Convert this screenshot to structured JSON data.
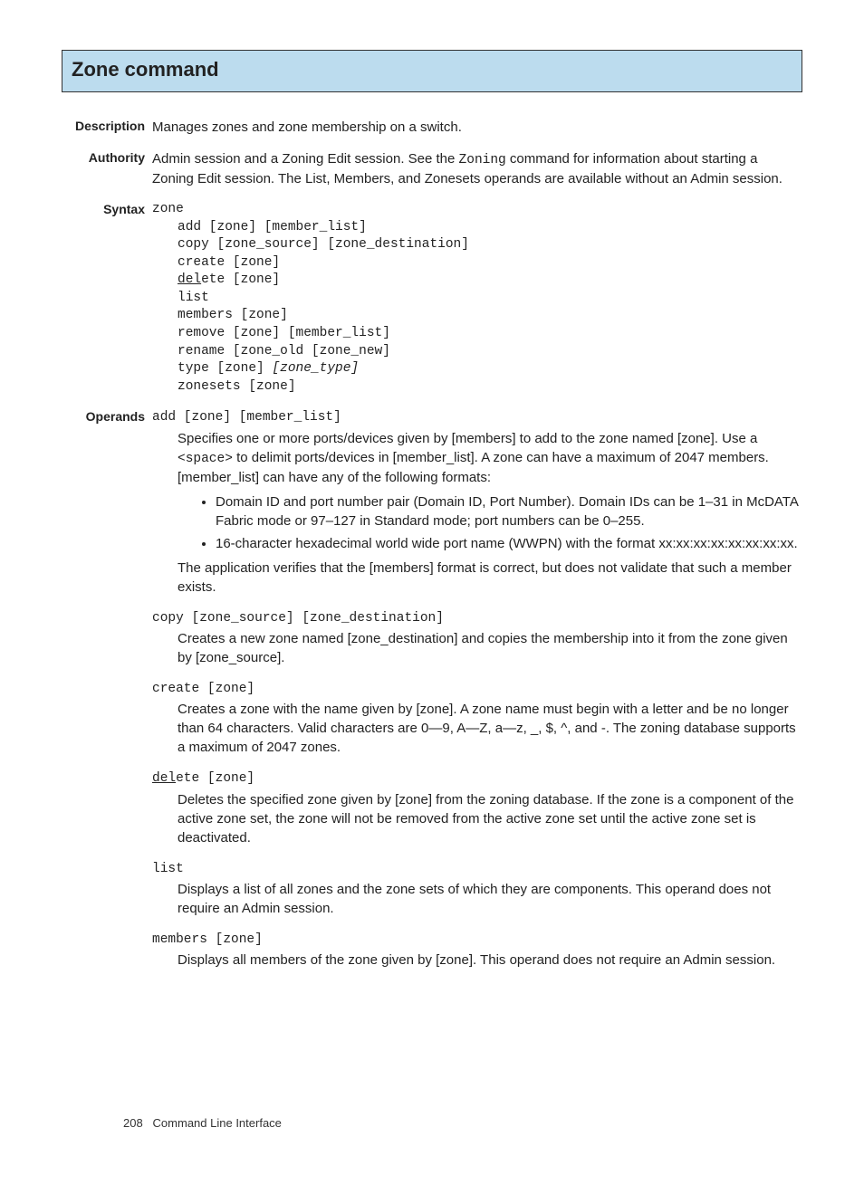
{
  "title": "Zone command",
  "description": {
    "label": "Description",
    "text": "Manages zones and zone membership on a switch."
  },
  "authority": {
    "label": "Authority",
    "pre": "Admin session and a Zoning Edit session. See the ",
    "cmd": "Zoning",
    "post": " command for information about starting a Zoning Edit session. The List, Members, and Zonesets operands are available without an Admin session."
  },
  "syntax": {
    "label": "Syntax",
    "keyword": "zone",
    "lines_pre": "add [zone] [member_list]\ncopy [zone_source] [zone_destination]\ncreate [zone]",
    "del_ul": "del",
    "del_rest": "ete [zone]",
    "lines_mid": "list\nmembers [zone]\nremove [zone] [member_list]\nrename [zone_old [zone_new]",
    "type_pre": "type [zone] ",
    "type_italic": "[zone_type]",
    "lines_post": "zonesets [zone]"
  },
  "operands": {
    "label": "Operands",
    "add": {
      "head": "add [zone] [member_list]",
      "p1a": "Specifies one or more ports/devices given by [members] to add to the zone named [zone]. Use a ",
      "p1b": "<space>",
      "p1c": " to delimit ports/devices in [member_list]. A zone can have a maximum of 2047 members. [member_list] can have any of the following formats:",
      "b1": "Domain ID and port number pair (Domain ID, Port Number). Domain IDs can be 1–31 in McDATA Fabric mode or 97–127 in Standard mode; port numbers can be 0–255.",
      "b2": "16-character hexadecimal world wide port name (WWPN) with the format xx:xx:xx:xx:xx:xx:xx:xx.",
      "p2": "The application verifies that the [members] format is correct, but does not validate that such a member exists."
    },
    "copy": {
      "head": "copy [zone_source] [zone_destination]",
      "desc": "Creates a new zone named [zone_destination] and copies the membership into it from the zone given by [zone_source]."
    },
    "create": {
      "head": "create [zone]",
      "desc": "Creates a zone with the name given by [zone]. A zone name must begin with a letter and be no longer than 64 characters. Valid characters are 0—9, A—Z, a—z, _, $, ^, and -. The zoning database supports a maximum of 2047 zones."
    },
    "delete": {
      "head_ul": "del",
      "head_rest": "ete [zone]",
      "desc": "Deletes the specified zone given by [zone] from the zoning database. If the zone is a component of the active zone set, the zone will not be removed from the active zone set until the active zone set is deactivated."
    },
    "list": {
      "head": "list",
      "desc": "Displays a list of all zones and the zone sets of which they are components. This operand does not require an Admin session."
    },
    "members": {
      "head": "members [zone]",
      "desc": "Displays all members of the zone given by [zone]. This operand does not require an Admin session."
    }
  },
  "footer": {
    "page": "208",
    "text": "Command Line Interface"
  }
}
